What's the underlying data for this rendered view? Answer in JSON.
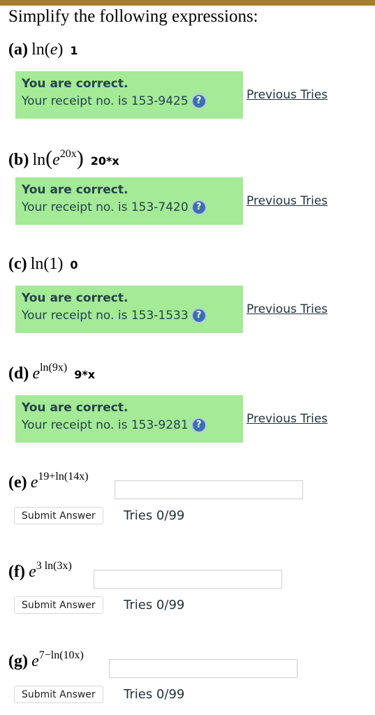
{
  "instruction": "Simplify the following expressions:",
  "parts": [
    {
      "label": "(a)",
      "fn": "ln",
      "arg": "e",
      "answer": "1",
      "status": "You are correct.",
      "receipt": "Your receipt no. is 153-9425",
      "previous": "Previous Tries"
    },
    {
      "label": "(b)",
      "fn": "ln",
      "base": "e",
      "exp": "20x",
      "answer": "20*x",
      "status": "You are correct.",
      "receipt": "Your receipt no. is 153-7420",
      "previous": "Previous Tries"
    },
    {
      "label": "(c)",
      "fn": "ln",
      "arg": "1",
      "answer": "0",
      "status": "You are correct.",
      "receipt": "Your receipt no. is 153-1533",
      "previous": "Previous Tries"
    },
    {
      "label": "(d)",
      "base": "e",
      "exp": "ln(9x)",
      "answer": "9*x",
      "status": "You are correct.",
      "receipt": "Your receipt no. is 153-9281",
      "previous": "Previous Tries"
    },
    {
      "label": "(e)",
      "base": "e",
      "exp": "19+ln(14x)",
      "input_value": "",
      "submit": "Submit Answer",
      "tries": "Tries 0/99"
    },
    {
      "label": "(f)",
      "base": "e",
      "exp": "3 ln(3x)",
      "input_value": "",
      "submit": "Submit Answer",
      "tries": "Tries 0/99"
    },
    {
      "label": "(g)",
      "base": "e",
      "exp": "7−ln(10x)",
      "input_value": "",
      "submit": "Submit Answer",
      "tries": "Tries 0/99"
    }
  ],
  "colors": {
    "correct_bg": "#a4ea97",
    "top_bar": "#a57d2c",
    "help_icon": "#3a6fb4"
  },
  "icons": {
    "help": "help-icon"
  }
}
